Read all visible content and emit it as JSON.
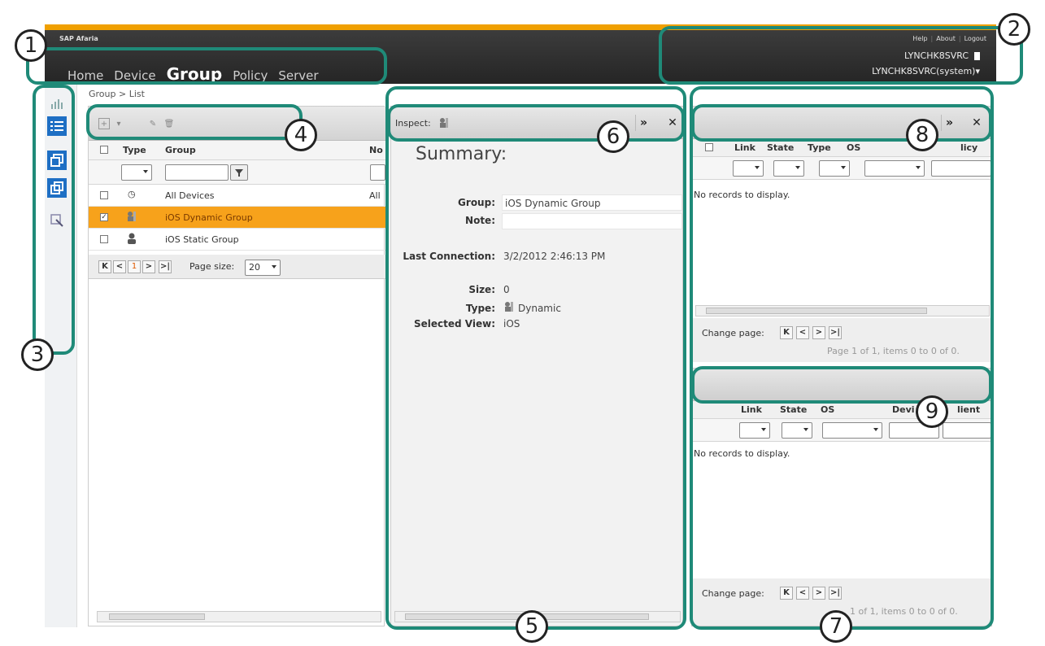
{
  "header": {
    "app_name": "SAP Afaria",
    "nav": [
      "Home",
      "Device",
      "Group",
      "Policy",
      "Server"
    ],
    "active_nav": "Group",
    "links": [
      "Help",
      "About",
      "Logout"
    ],
    "server_name": "LYNCHK8SVRC",
    "user_name": "LYNCHK8SVRC(system)▾"
  },
  "breadcrumb": "Group > List",
  "group_list": {
    "columns": [
      "Type",
      "Group",
      "No"
    ],
    "rows": [
      {
        "type_icon": "dynamic-group-icon",
        "group": "All Devices",
        "note": "All",
        "selected": false,
        "checked": false
      },
      {
        "type_icon": "dynamic-group-icon",
        "group": "iOS Dynamic Group",
        "note": "",
        "selected": true,
        "checked": true
      },
      {
        "type_icon": "static-group-icon",
        "group": "iOS Static Group",
        "note": "",
        "selected": false,
        "checked": false
      }
    ],
    "pager": {
      "current_page": "1",
      "page_size_label": "Page size:",
      "page_size": "20"
    }
  },
  "inspect": {
    "title": "Inspect:",
    "summary_title": "Summary:",
    "fields": {
      "group_label": "Group:",
      "group": "iOS Dynamic Group",
      "note_label": "Note:",
      "note": "",
      "last_connection_label": "Last Connection:",
      "last_connection": "3/2/2012 2:46:13 PM",
      "size_label": "Size:",
      "size": "0",
      "type_label": "Type:",
      "type": "Dynamic",
      "selected_view_label": "Selected View:",
      "selected_view": "iOS"
    }
  },
  "top_right_panel": {
    "columns": [
      "Link",
      "State",
      "Type",
      "OS",
      "licy"
    ],
    "empty_text": "No records to display.",
    "change_page_label": "Change page:",
    "page_info": "Page 1 of 1, items 0 to 0 of 0."
  },
  "bottom_right_panel": {
    "columns": [
      "Link",
      "State",
      "OS",
      "Devi",
      "lient"
    ],
    "empty_text": "No records to display.",
    "change_page_label": "Change page:",
    "page_info": "1 of 1, items 0 to 0 of 0."
  },
  "callouts": [
    "1",
    "2",
    "3",
    "4",
    "5",
    "6",
    "7",
    "8",
    "9"
  ],
  "colors": {
    "accent_orange": "#f0a000",
    "selected_row": "#f7a21b",
    "highlight": "#1f8a78",
    "sidebar_blue": "#1e6fc4"
  }
}
